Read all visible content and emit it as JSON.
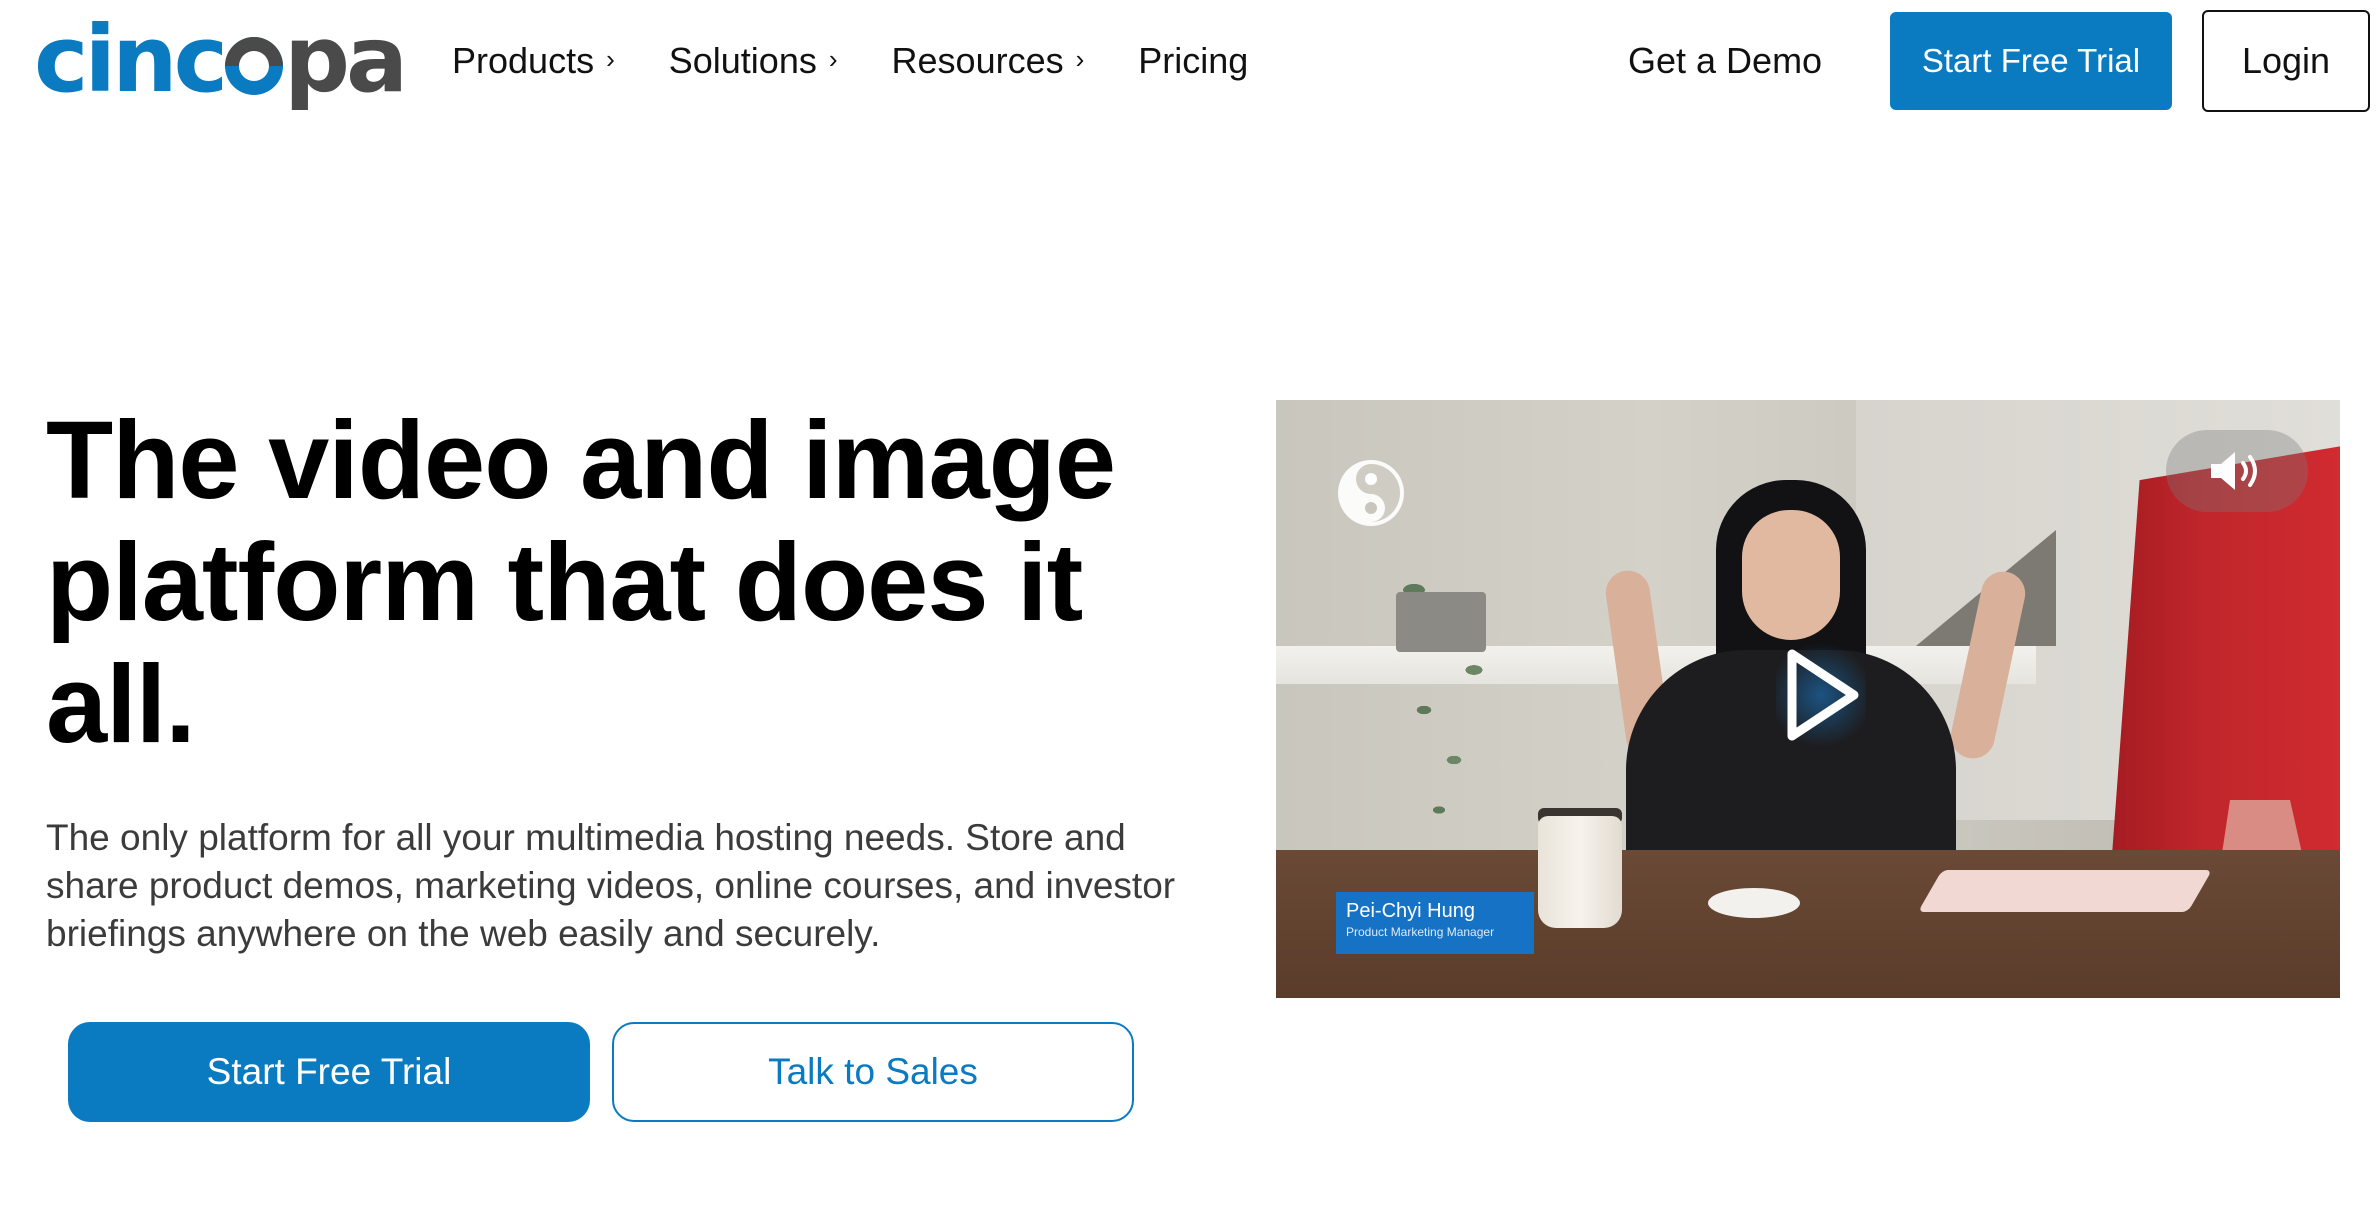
{
  "brand": {
    "logo_text_left": "cinc",
    "logo_text_right": "pa",
    "accent_color": "#0a7bc1",
    "logo_gray": "#4a4a4a"
  },
  "nav": {
    "items": [
      {
        "label": "Products",
        "has_submenu": true
      },
      {
        "label": "Solutions",
        "has_submenu": true
      },
      {
        "label": "Resources",
        "has_submenu": true
      },
      {
        "label": "Pricing",
        "has_submenu": false
      }
    ],
    "chevron": "›"
  },
  "header_actions": {
    "get_demo": "Get a Demo",
    "start_trial": "Start Free Trial",
    "login": "Login"
  },
  "hero": {
    "title": "The video and image platform that does it all.",
    "subtitle": "The only platform for all your multimedia hosting needs. Store and share product demos, marketing videos, online courses, and investor briefings anywhere on the web easily and securely.",
    "cta_primary": "Start Free Trial",
    "cta_secondary": "Talk to Sales"
  },
  "video": {
    "icons": {
      "play": "play-icon",
      "mute": "speaker-icon",
      "brand": "cincopa-s-icon"
    },
    "caption": {
      "name": "Pei-Chyi Hung",
      "role": "Product Marketing Manager"
    }
  }
}
